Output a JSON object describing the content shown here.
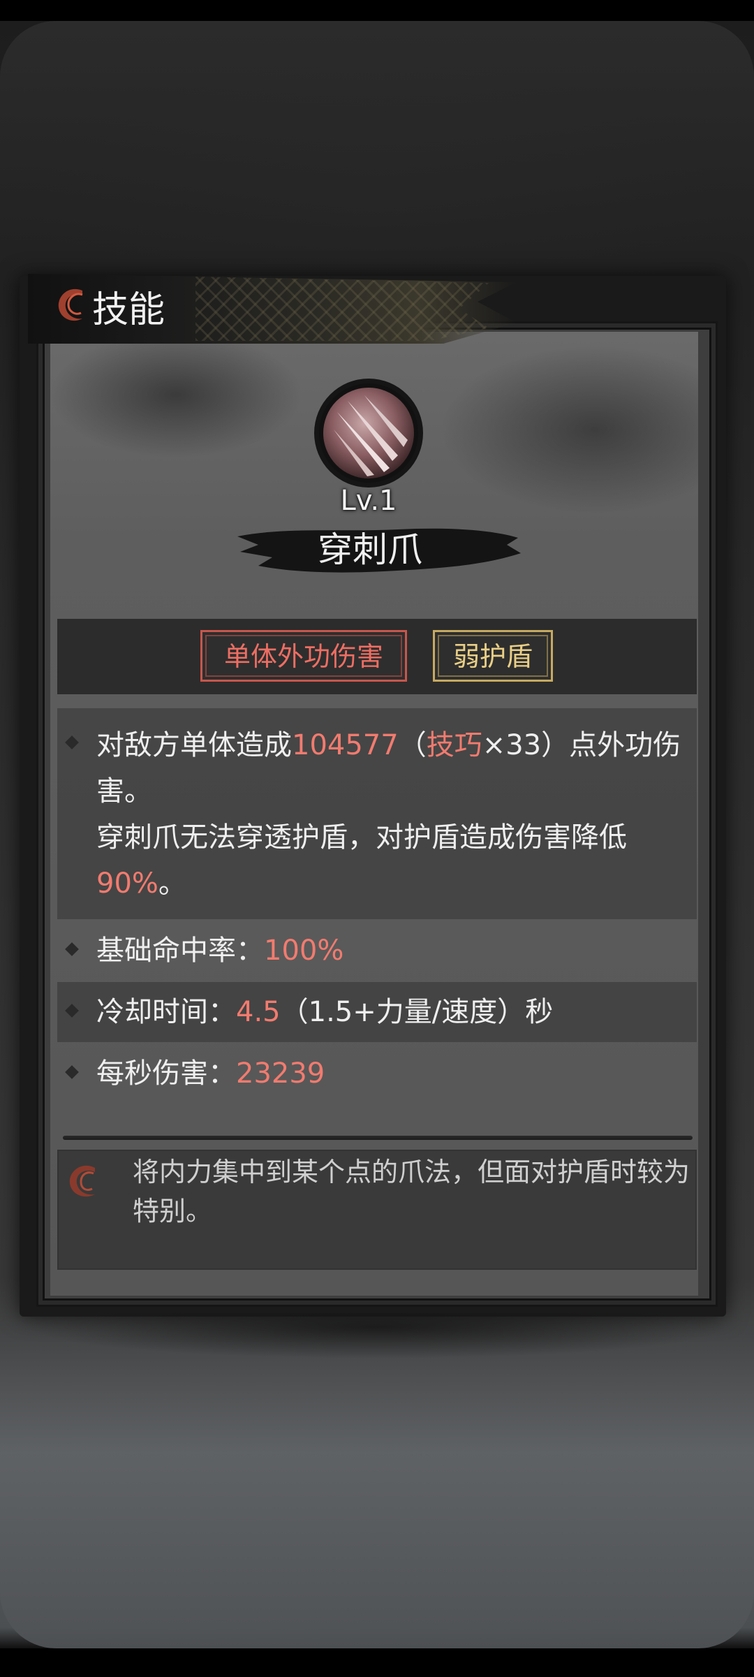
{
  "header": {
    "title": "技能",
    "icon": "swirl-icon"
  },
  "skill": {
    "icon": "claw-orb-icon",
    "level": "Lv.1",
    "name": "穿刺爪"
  },
  "tags": [
    {
      "label": "单体外功伤害",
      "color": "#ee6e63"
    },
    {
      "label": "弱护盾",
      "color": "#e9cf86"
    }
  ],
  "description": {
    "damage": {
      "prefix": "对敌方单体造成",
      "value": "104577",
      "paren_open": "（",
      "stat": "技巧",
      "multiplier": "×33）点外功伤害。",
      "line2": "穿刺爪无法穿透护盾，对护盾造成伤害降低",
      "reduction": "90%",
      "end": "。"
    },
    "hit_rate": {
      "label": "基础命中率：",
      "value": "100%"
    },
    "cooldown": {
      "label": "冷却时间：",
      "value": "4.5",
      "formula": "（1.5+力量/速度）秒"
    },
    "dps": {
      "label": "每秒伤害：",
      "value": "23239"
    }
  },
  "flavor": {
    "icon": "swirl-icon",
    "text": "将内力集中到某个点的爪法，但面对护盾时较为特别。"
  },
  "colors": {
    "highlight": "#f27b6f",
    "accent_red": "#c8564c",
    "accent_gold": "#c7aa60"
  }
}
